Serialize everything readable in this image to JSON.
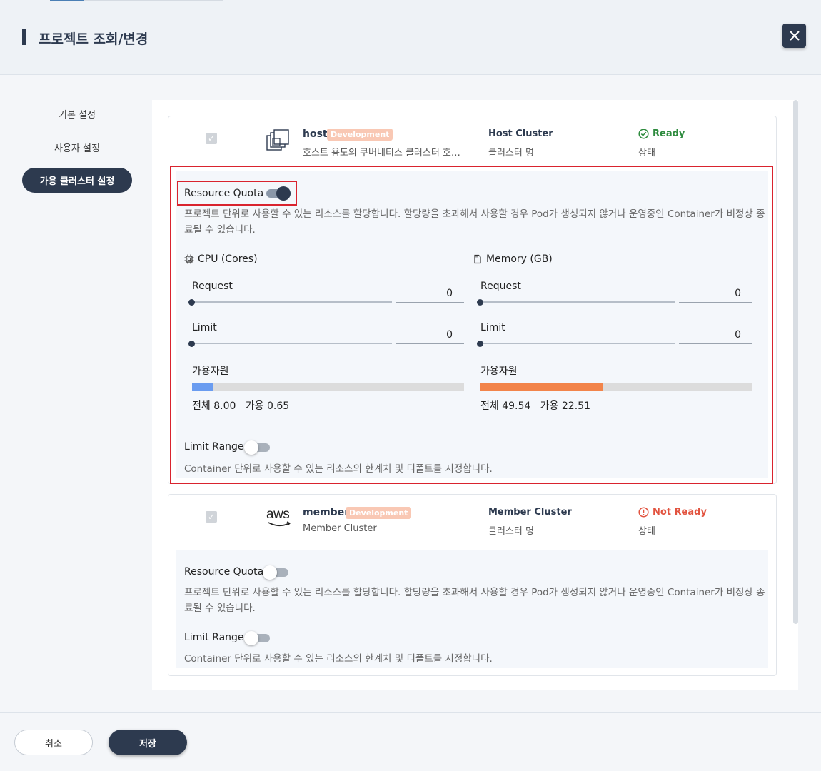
{
  "header": {
    "title": "프로젝트 조회/변경",
    "close_icon": "close-icon"
  },
  "sidebar": {
    "items": [
      {
        "label": "기본 설정"
      },
      {
        "label": "사용자 설정"
      },
      {
        "label": "가용 클러스터 설정",
        "active": true
      }
    ]
  },
  "clusters": [
    {
      "name": "host",
      "tag": "Development",
      "description": "호스트 용도의 쿠버네티스 클러스터 호스트",
      "type": "Host Cluster",
      "type_sub": "클러스터 명",
      "status": "Ready",
      "status_sub": "상태",
      "status_color": "#2e8b3e",
      "icon": "cluster-stack-icon",
      "resource_quota": {
        "label": "Resource Quota",
        "enabled": true,
        "description": "프로젝트 단위로 사용할 수 있는 리소스를 할당합니다. 할당량을 초과해서 사용할 경우 Pod가 생성되지 않거나 운영중인 Container가 비정상 종료될 수 있습니다.",
        "cpu": {
          "title": "CPU (Cores)",
          "icon": "cpu-icon",
          "request_label": "Request",
          "request_value": "0",
          "limit_label": "Limit",
          "limit_value": "0",
          "avail_label": "가용자원",
          "usage_fraction": 0.08,
          "bar_color": "#6a9cf0",
          "total_label": "전체",
          "total": "8.00",
          "avail_word": "가용",
          "available": "0.65"
        },
        "memory": {
          "title": "Memory (GB)",
          "icon": "memory-icon",
          "request_label": "Request",
          "request_value": "0",
          "limit_label": "Limit",
          "limit_value": "0",
          "avail_label": "가용자원",
          "usage_fraction": 0.45,
          "bar_color": "#f2844a",
          "total_label": "전체",
          "total": "49.54",
          "avail_word": "가용",
          "available": "22.51"
        }
      },
      "limit_range": {
        "label": "Limit Range",
        "enabled": false,
        "description": "Container 단위로 사용할 수 있는 리소스의 한계치 및 디폴트를 지정합니다."
      }
    },
    {
      "name": "member",
      "tag": "Development",
      "description": "Member Cluster",
      "type": "Member Cluster",
      "type_sub": "클러스터 명",
      "status": "Not Ready",
      "status_sub": "상태",
      "status_color": "#e2533f",
      "icon": "aws-icon",
      "icon_text": "aws",
      "resource_quota": {
        "label": "Resource Quota",
        "enabled": false,
        "description": "프로젝트 단위로 사용할 수 있는 리소스를 할당합니다. 할당량을 초과해서 사용할 경우 Pod가 생성되지 않거나 운영중인 Container가 비정상 종료될 수 있습니다."
      },
      "limit_range": {
        "label": "Limit Range",
        "enabled": false,
        "description": "Container 단위로 사용할 수 있는 리소스의 한계치 및 디폴트를 지정합니다."
      }
    }
  ],
  "footer": {
    "cancel_label": "취소",
    "save_label": "저장"
  }
}
